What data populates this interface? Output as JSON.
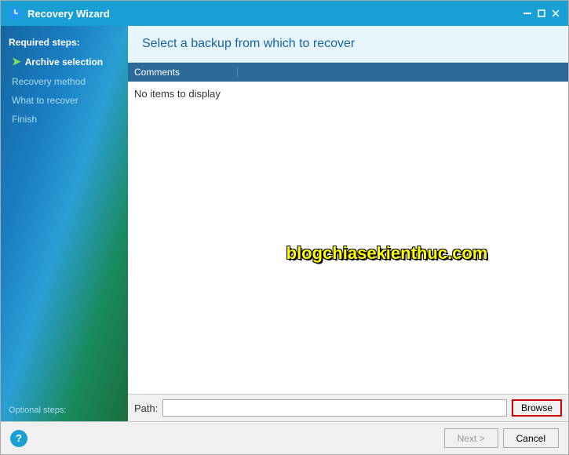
{
  "titleBar": {
    "title": "Recovery Wizard",
    "icon": "recovery-icon",
    "minimizeLabel": "_",
    "closeLabel": "✕"
  },
  "sidebar": {
    "requiredLabel": "Required steps:",
    "items": [
      {
        "id": "archive-selection",
        "label": "Archive selection",
        "active": true,
        "hasArrow": true
      },
      {
        "id": "recovery-method",
        "label": "Recovery method",
        "active": false,
        "hasArrow": false
      },
      {
        "id": "what-to-recover",
        "label": "What to recover",
        "active": false,
        "hasArrow": false
      },
      {
        "id": "finish",
        "label": "Finish",
        "active": false,
        "hasArrow": false
      }
    ],
    "optionalLabel": "Optional steps:"
  },
  "header": {
    "title": "Select a backup from which to recover"
  },
  "table": {
    "columns": [
      {
        "id": "comments",
        "label": "Comments"
      }
    ],
    "noItemsText": "No items to display"
  },
  "watermark": {
    "text": "blogchiasekienthuc.com"
  },
  "pathRow": {
    "label": "Path:",
    "placeholder": "",
    "browseLabel": "Browse"
  },
  "footer": {
    "nextLabel": "Next >",
    "cancelLabel": "Cancel",
    "helpLabel": "?"
  }
}
